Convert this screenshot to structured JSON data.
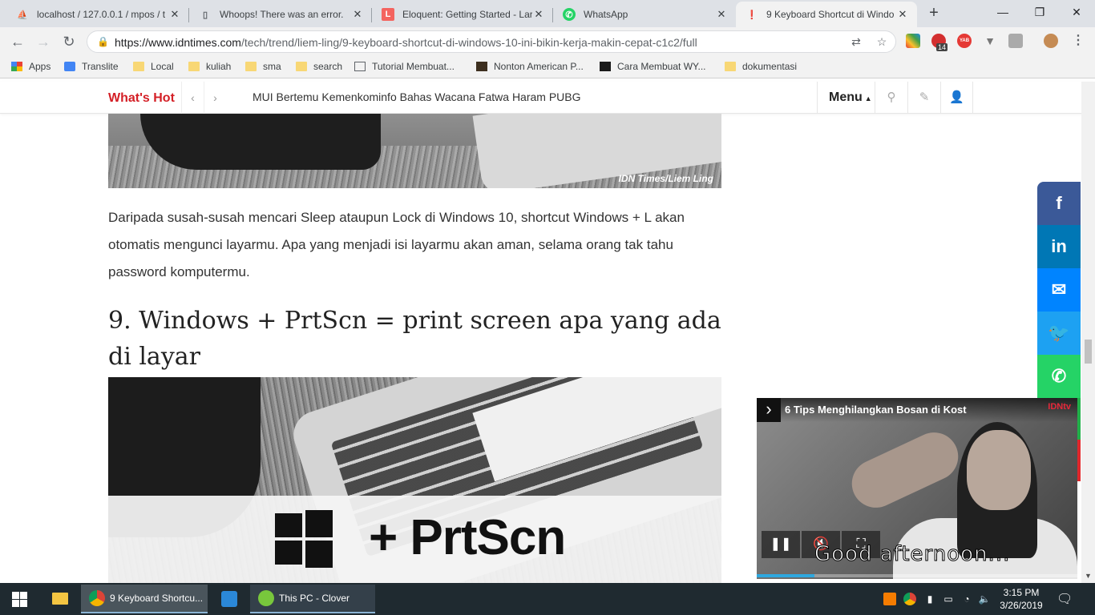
{
  "browser": {
    "tabs": [
      {
        "title": "localhost / 127.0.0.1 / mpos / t",
        "icon": "phpmyadmin-icon",
        "close": "✕"
      },
      {
        "title": "Whoops! There was an error.",
        "icon": "page-icon",
        "close": "✕"
      },
      {
        "title": "Eloquent: Getting Started - Lar",
        "icon": "laravel-icon",
        "close": "✕"
      },
      {
        "title": "WhatsApp",
        "icon": "whatsapp-icon",
        "close": "✕"
      },
      {
        "title": "9 Keyboard Shortcut di Windo",
        "icon": "idntimes-icon",
        "close": "✕"
      }
    ],
    "new_tab": "+",
    "window_controls": {
      "minimize": "—",
      "restore": "❐",
      "close": "✕"
    },
    "nav": {
      "back": "←",
      "forward": "→",
      "reload": "↻"
    },
    "url_host": "https://www.idntimes.com",
    "url_path": "/tech/trend/liem-ling/9-keyboard-shortcut-di-windows-10-ini-bikin-kerja-makin-cepat-c1c2/full",
    "extension_badge": "14",
    "extension_yab": "YAB",
    "bookmarks": [
      {
        "label": "Apps",
        "icon": "apps-grid-icon"
      },
      {
        "label": "Translite",
        "icon": "google-translate-icon"
      },
      {
        "label": "Local",
        "icon": "folder-icon"
      },
      {
        "label": "kuliah",
        "icon": "folder-icon"
      },
      {
        "label": "sma",
        "icon": "folder-icon"
      },
      {
        "label": "search",
        "icon": "folder-icon"
      },
      {
        "label": "Tutorial Membuat...",
        "icon": "code-icon"
      },
      {
        "label": "Nonton American P...",
        "icon": "film-icon"
      },
      {
        "label": "Cara Membuat WY...",
        "icon": "ik-icon"
      },
      {
        "label": "dokumentasi",
        "icon": "folder-icon"
      }
    ]
  },
  "site": {
    "whats_hot": "What's Hot",
    "ticker": "MUI Bertemu Kemenkominfo Bahas Wacana Fatwa Haram PUBG",
    "menu": "Menu",
    "accent": "#d41f26"
  },
  "article": {
    "top_photo_credit": "IDN Times/Liem Ling",
    "paragraph": "Daripada susah-susah mencari Sleep ataupun Lock di Windows 10, shortcut Windows + L akan otomatis mengunci layarmu. Apa yang menjadi isi layarmu akan aman, selama orang tak tahu password komputermu.",
    "heading": "9. Windows + PrtScn = print screen apa yang ada di layar",
    "image_text": "+ PrtScn"
  },
  "share": [
    {
      "network": "facebook",
      "glyph": "f",
      "color": "#3b5998"
    },
    {
      "network": "linkedin",
      "glyph": "in",
      "color": "#0077b5"
    },
    {
      "network": "messenger",
      "glyph": "✉",
      "color": "#0084ff"
    },
    {
      "network": "twitter",
      "glyph": "🐦",
      "color": "#1da1f2"
    },
    {
      "network": "whatsapp",
      "glyph": "✆",
      "color": "#25d366"
    }
  ],
  "video": {
    "title": "6 Tips Menghilangkan Bosan di Kost",
    "brand": "IDNtv",
    "subtitle": "Good afternoon...",
    "progress": 0.18
  },
  "taskbar": {
    "items": [
      {
        "label": "9 Keyboard Shortcu...",
        "icon": "chrome-icon"
      },
      {
        "label": "This PC - Clover",
        "icon": "clover-icon"
      }
    ],
    "time": "3:15 PM",
    "date": "3/26/2019"
  }
}
